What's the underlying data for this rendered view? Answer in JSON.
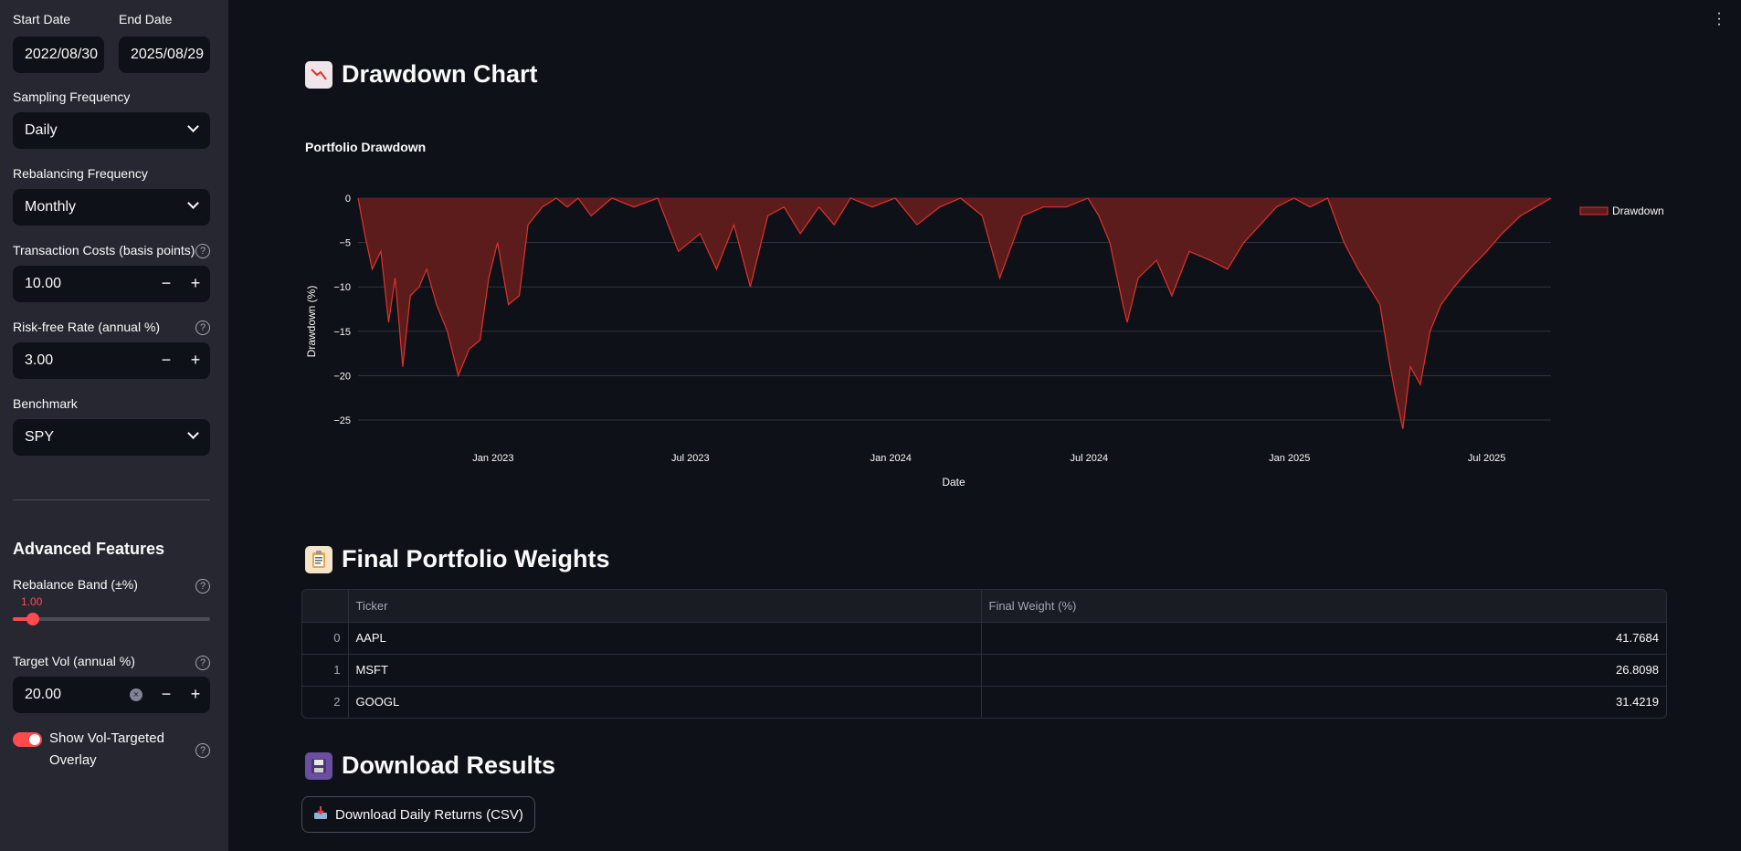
{
  "sidebar": {
    "start_date_label": "Start Date",
    "start_date_value": "2022/08/30",
    "end_date_label": "End Date",
    "end_date_value": "2025/08/29",
    "sampling_label": "Sampling Frequency",
    "sampling_value": "Daily",
    "rebalancing_label": "Rebalancing Frequency",
    "rebalancing_value": "Monthly",
    "tc_label": "Transaction Costs (basis points)",
    "tc_value": "10.00",
    "rf_label": "Risk-free Rate (annual %)",
    "rf_value": "3.00",
    "benchmark_label": "Benchmark",
    "benchmark_value": "SPY",
    "advanced_title": "Advanced Features",
    "band_label": "Rebalance Band (±%)",
    "band_value": "1.00",
    "band_fraction": 0.1,
    "vol_label": "Target Vol (annual %)",
    "vol_value": "20.00",
    "overlay_label_line1": "Show Vol-Targeted",
    "overlay_label_line2": "Overlay",
    "overlay_on": true,
    "help_glyph": "?",
    "minus": "−",
    "plus": "+"
  },
  "main": {
    "drawdown_heading": "Drawdown Chart",
    "drawdown_icon": "chart-decreasing-icon",
    "weights_heading": "Final Portfolio Weights",
    "weights_icon": "clipboard-icon",
    "download_heading": "Download Results",
    "download_icon": "floppy-disk-icon",
    "download_button": "Download Daily Returns (CSV)",
    "table": {
      "columns": [
        "",
        "Ticker",
        "Final Weight (%)"
      ],
      "rows": [
        {
          "index": "0",
          "ticker": "AAPL",
          "weight": "41.7684"
        },
        {
          "index": "1",
          "ticker": "MSFT",
          "weight": "26.8098"
        },
        {
          "index": "2",
          "ticker": "GOOGL",
          "weight": "31.4219"
        }
      ]
    }
  },
  "colors": {
    "accent": "#ff4b4b",
    "line": "#e0322c",
    "fill": "#5c1c1c"
  },
  "chart_data": {
    "type": "area",
    "title": "Portfolio Drawdown",
    "xlabel": "Date",
    "ylabel": "Drawdown (%)",
    "ylim": [
      -27,
      0.5
    ],
    "yticks": [
      0,
      -5,
      -10,
      -15,
      -20,
      -25
    ],
    "xticks": [
      "Jan 2023",
      "Jul 2023",
      "Jan 2024",
      "Jul 2024",
      "Jan 2025",
      "Jul 2025"
    ],
    "xtick_dates": [
      "2023-01-01",
      "2023-07-01",
      "2024-01-01",
      "2024-07-01",
      "2025-01-01",
      "2025-07-01"
    ],
    "xlim": [
      "2022-08-30",
      "2025-08-29"
    ],
    "legend": "top-right",
    "series": [
      {
        "name": "Drawdown",
        "x": [
          "2022-08-30",
          "2022-09-05",
          "2022-09-12",
          "2022-09-20",
          "2022-09-27",
          "2022-10-03",
          "2022-10-10",
          "2022-10-17",
          "2022-10-25",
          "2022-11-01",
          "2022-11-10",
          "2022-11-20",
          "2022-11-30",
          "2022-12-10",
          "2022-12-20",
          "2022-12-28",
          "2023-01-05",
          "2023-01-15",
          "2023-01-25",
          "2023-02-02",
          "2023-02-15",
          "2023-02-28",
          "2023-03-10",
          "2023-03-20",
          "2023-04-01",
          "2023-04-20",
          "2023-05-10",
          "2023-06-01",
          "2023-06-20",
          "2023-07-10",
          "2023-07-25",
          "2023-08-10",
          "2023-08-25",
          "2023-09-10",
          "2023-09-25",
          "2023-10-10",
          "2023-10-27",
          "2023-11-10",
          "2023-11-25",
          "2023-12-15",
          "2024-01-05",
          "2024-01-25",
          "2024-02-15",
          "2024-03-05",
          "2024-03-25",
          "2024-04-10",
          "2024-04-19",
          "2024-05-01",
          "2024-05-20",
          "2024-06-10",
          "2024-06-30",
          "2024-07-10",
          "2024-07-20",
          "2024-08-01",
          "2024-08-05",
          "2024-08-15",
          "2024-09-01",
          "2024-09-15",
          "2024-10-01",
          "2024-10-20",
          "2024-11-05",
          "2024-11-20",
          "2024-12-05",
          "2024-12-20",
          "2025-01-05",
          "2025-01-20",
          "2025-02-05",
          "2025-02-20",
          "2025-03-05",
          "2025-03-15",
          "2025-03-25",
          "2025-04-02",
          "2025-04-08",
          "2025-04-15",
          "2025-04-22",
          "2025-05-01",
          "2025-05-10",
          "2025-05-20",
          "2025-06-01",
          "2025-06-15",
          "2025-07-01",
          "2025-07-15",
          "2025-08-01",
          "2025-08-15",
          "2025-08-29"
        ],
        "y": [
          0,
          -4,
          -8,
          -6,
          -14,
          -9,
          -19,
          -11,
          -10,
          -8,
          -12,
          -15,
          -20,
          -17,
          -16,
          -9,
          -5,
          -12,
          -11,
          -3,
          -1,
          0,
          -1,
          0,
          -2,
          0,
          -1,
          0,
          -6,
          -4,
          -8,
          -3,
          -10,
          -2,
          -1,
          -4,
          -1,
          -3,
          0,
          -1,
          0,
          -3,
          -1,
          0,
          -2,
          -9,
          -6,
          -2,
          -1,
          -1,
          0,
          -2,
          -5,
          -12,
          -14,
          -9,
          -7,
          -11,
          -6,
          -7,
          -8,
          -5,
          -3,
          -1,
          0,
          -1,
          0,
          -5,
          -8,
          -10,
          -12,
          -18,
          -22,
          -26,
          -19,
          -21,
          -15,
          -12,
          -10,
          -8,
          -6,
          -4,
          -2,
          -1,
          0
        ]
      }
    ]
  }
}
